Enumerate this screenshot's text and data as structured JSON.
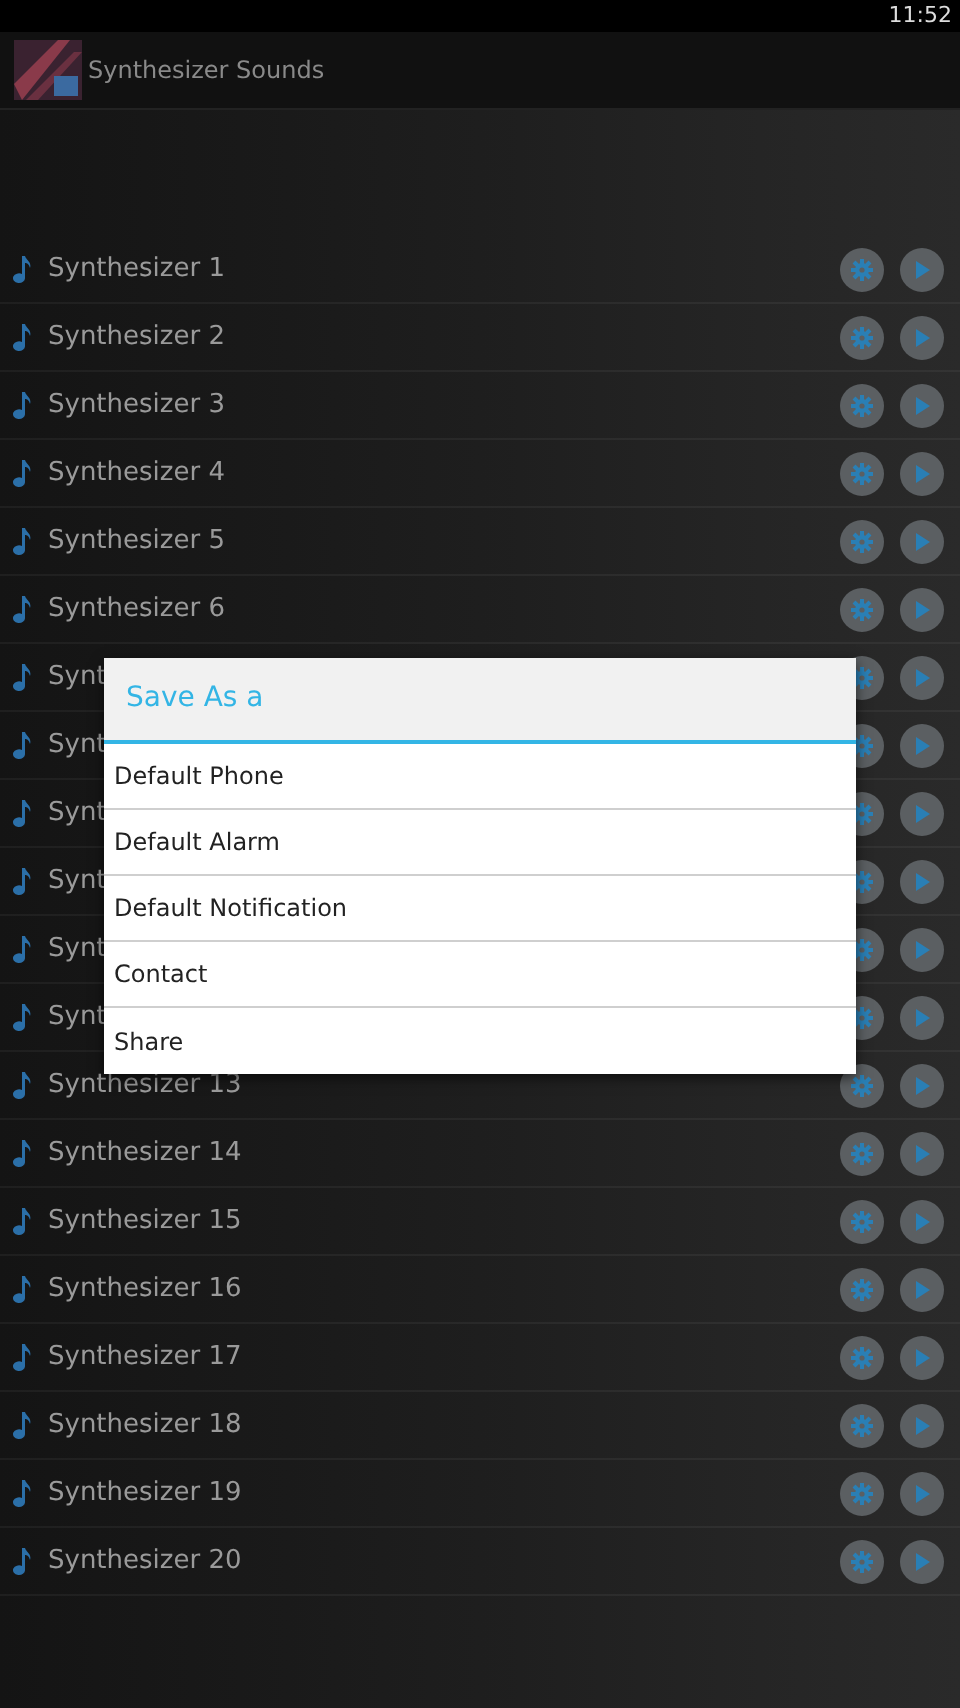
{
  "status_bar": {
    "time": "11:52"
  },
  "action_bar": {
    "title": "Synthesizer Sounds"
  },
  "sounds": [
    {
      "name": "Synthesizer 1"
    },
    {
      "name": "Synthesizer 2"
    },
    {
      "name": "Synthesizer 3"
    },
    {
      "name": "Synthesizer 4"
    },
    {
      "name": "Synthesizer 5"
    },
    {
      "name": "Synthesizer 6"
    },
    {
      "name": "Synt"
    },
    {
      "name": "Synt"
    },
    {
      "name": "Synt"
    },
    {
      "name": "Synt"
    },
    {
      "name": "Synt"
    },
    {
      "name": "Synt"
    },
    {
      "name": "Synthesizer 13"
    },
    {
      "name": "Synthesizer 14"
    },
    {
      "name": "Synthesizer 15"
    },
    {
      "name": "Synthesizer 16"
    },
    {
      "name": "Synthesizer 17"
    },
    {
      "name": "Synthesizer 18"
    },
    {
      "name": "Synthesizer 19"
    },
    {
      "name": "Synthesizer 20"
    }
  ],
  "dialog": {
    "title": "Save As a",
    "options": [
      "Default Phone",
      "Default Alarm",
      "Default Notification",
      "Contact",
      "Share"
    ]
  }
}
